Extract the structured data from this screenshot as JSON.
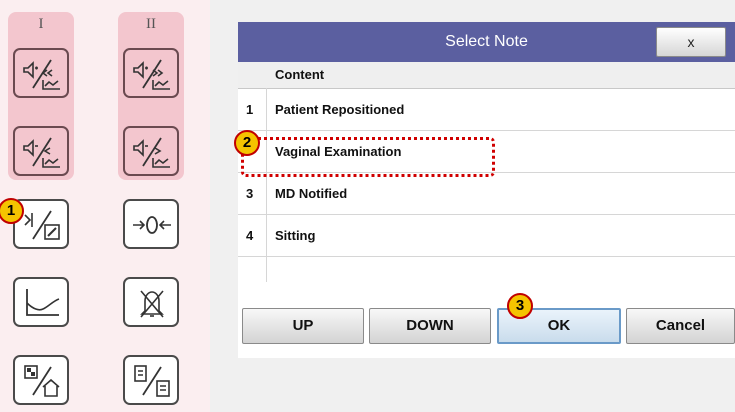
{
  "keypad": {
    "col1_header": "I",
    "col2_header": "II",
    "keys": [
      {
        "id": "ecg1-up-key",
        "icon": "record-speed-up-icon"
      },
      {
        "id": "ecg2-up-key",
        "icon": "record-speed-up-icon"
      },
      {
        "id": "ecg1-down-key",
        "icon": "record-speed-down-icon"
      },
      {
        "id": "ecg2-down-key",
        "icon": "record-speed-down-icon"
      },
      {
        "id": "note-key",
        "icon": "note-edit-icon"
      },
      {
        "id": "zero-key",
        "icon": "zero-adjust-icon"
      },
      {
        "id": "trend-key",
        "icon": "trend-graph-icon"
      },
      {
        "id": "silence-key",
        "icon": "alarm-silence-icon"
      },
      {
        "id": "home-key",
        "icon": "home-screen-icon"
      },
      {
        "id": "report-key",
        "icon": "report-print-icon"
      }
    ]
  },
  "dialog": {
    "title": "Select Note",
    "close_label": "x",
    "column_header": "Content",
    "rows": [
      {
        "num": "1",
        "text": "Patient Repositioned"
      },
      {
        "num": "",
        "text": "Vaginal Examination"
      },
      {
        "num": "3",
        "text": "MD Notified"
      },
      {
        "num": "4",
        "text": "Sitting"
      }
    ],
    "buttons": {
      "up": "UP",
      "down": "DOWN",
      "ok": "OK",
      "cancel": "Cancel"
    }
  },
  "markers": [
    "1",
    "2",
    "3"
  ],
  "colors": {
    "titlebar": "#5b5fa0",
    "marker_fill": "#f5c400",
    "marker_border": "#c00000",
    "panel_pink": "#f3c6ce"
  }
}
